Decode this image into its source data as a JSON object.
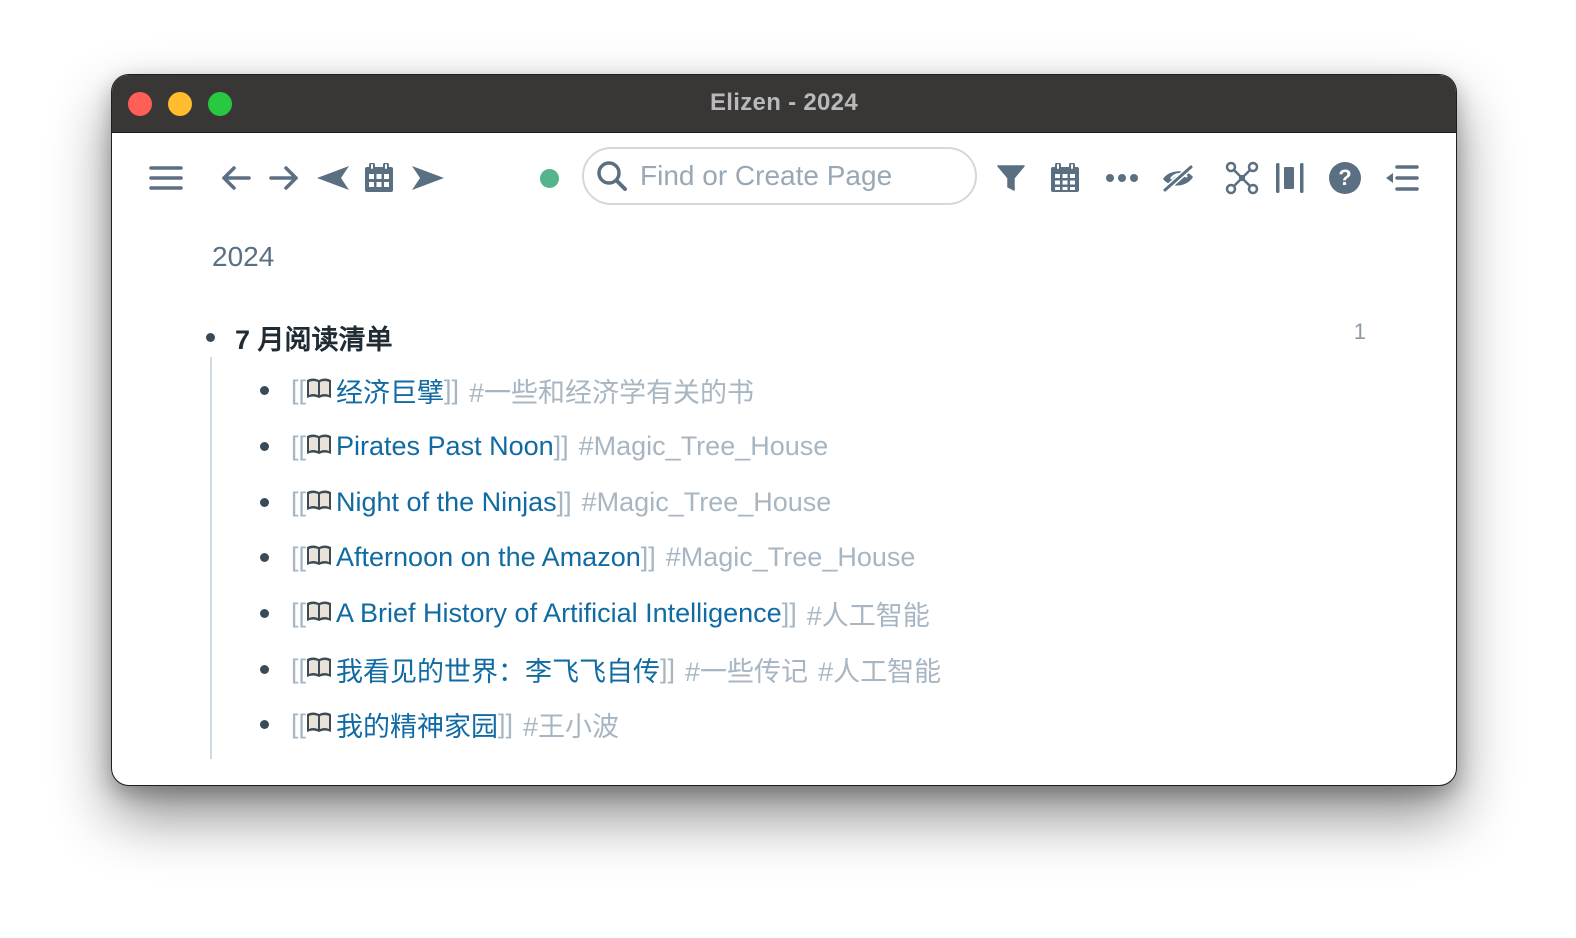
{
  "window": {
    "title": "Elizen - 2024",
    "controls": {
      "close": "close",
      "minimize": "minimize",
      "maximize": "maximize"
    }
  },
  "toolbar": {
    "left_icons": [
      {
        "name": "menu-icon",
        "label": "Toggle sidebar"
      },
      {
        "name": "arrow-left-icon",
        "label": "Back"
      },
      {
        "name": "arrow-right-icon",
        "label": "Forward"
      },
      {
        "name": "previous-day-icon",
        "label": "Previous daily note"
      },
      {
        "name": "calendar-icon",
        "label": "Daily notes"
      },
      {
        "name": "next-day-icon",
        "label": "Next daily note"
      }
    ],
    "sync_status_color": "#55b48a",
    "search": {
      "placeholder": "Find or Create Page",
      "value": ""
    },
    "right_icons": [
      {
        "name": "filter-icon",
        "label": "Filter"
      },
      {
        "name": "calendar-grid-icon",
        "label": "Calendar"
      },
      {
        "name": "more-icon",
        "label": "More"
      },
      {
        "name": "eye-slash-icon",
        "label": "Hide"
      },
      {
        "name": "graph-icon",
        "label": "Graph view"
      },
      {
        "name": "columns-icon",
        "label": "Layout"
      },
      {
        "name": "help-icon",
        "label": "Help"
      },
      {
        "name": "outdent-icon",
        "label": "Right sidebar"
      }
    ]
  },
  "page": {
    "title": "2024",
    "root_block": {
      "text": "7 月阅读清单",
      "child_count": "1",
      "children": [
        {
          "open": "[[",
          "emoji": "📖",
          "title": "经济巨擘",
          "close": "]]",
          "tags": [
            "#一些和经济学有关的书"
          ]
        },
        {
          "open": "[[",
          "emoji": "📖",
          "title": "Pirates Past Noon",
          "close": "]]",
          "tags": [
            "#Magic_Tree_House"
          ]
        },
        {
          "open": "[[",
          "emoji": "📖",
          "title": "Night of the Ninjas",
          "close": "]]",
          "tags": [
            "#Magic_Tree_House"
          ]
        },
        {
          "open": "[[",
          "emoji": "📖",
          "title": "Afternoon on the Amazon",
          "close": "]]",
          "tags": [
            "#Magic_Tree_House"
          ]
        },
        {
          "open": "[[",
          "emoji": "📖",
          "title": "A Brief History of Artificial Intelligence",
          "close": "]]",
          "tags": [
            "#人工智能"
          ]
        },
        {
          "open": "[[",
          "emoji": "📖",
          "title": "我看见的世界：李飞飞自传",
          "close": "]]",
          "tags": [
            "#一些传记",
            "#人工智能"
          ]
        },
        {
          "open": "[[",
          "emoji": "📖",
          "title": "我的精神家园",
          "close": "]]",
          "tags": [
            "#王小波"
          ]
        }
      ]
    }
  },
  "colors": {
    "icon": "#5b6f82",
    "link": "#106ba3",
    "bracket_tag": "#a7b6c2",
    "titlebar": "#383736"
  }
}
